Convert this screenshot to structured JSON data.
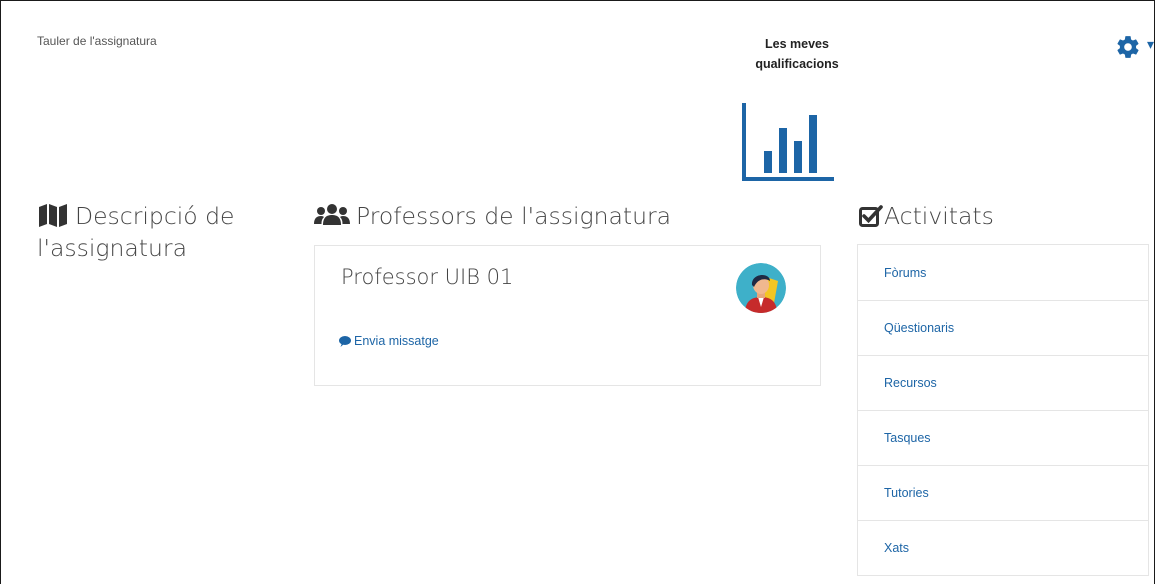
{
  "header": {
    "breadcrumb": "Tauler de l'assignatura",
    "grades_label": "Les meves qualificacions",
    "settings_caret": "▾"
  },
  "sections": {
    "description_title": "Descripció de l'assignatura",
    "teachers_title": "Professors de l'assignatura",
    "activities_title": "Activitats"
  },
  "teacher": {
    "name": "Professor UIB 01",
    "message_label": "Envia missatge"
  },
  "activities": [
    {
      "label": "Fòrums"
    },
    {
      "label": "Qüestionaris"
    },
    {
      "label": "Recursos"
    },
    {
      "label": "Tasques"
    },
    {
      "label": "Tutories"
    },
    {
      "label": "Xats"
    }
  ],
  "icons": {
    "settings": "gear-icon",
    "grades": "bar-chart-icon",
    "description": "map-icon",
    "teachers": "users-icon",
    "activities": "checkbox-icon",
    "message": "comment-icon"
  },
  "colors": {
    "accent": "#1d65a6",
    "text": "#444444",
    "border": "#e5e5e5"
  }
}
